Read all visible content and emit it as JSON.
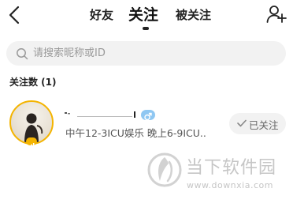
{
  "header": {
    "back_icon": "chevron-left-icon",
    "tabs": [
      {
        "label": "好友",
        "active": false
      },
      {
        "label": "关注",
        "active": true
      },
      {
        "label": "被关注",
        "active": false
      }
    ],
    "add_user_icon": "add-user-icon"
  },
  "search": {
    "placeholder": "请搜索昵称或ID",
    "value": ""
  },
  "section": {
    "title": "关注数 (1)"
  },
  "users": [
    {
      "signature": "中午12-3ICU娱乐 晚上6-9ICU..",
      "gender_icon": "male-icon",
      "button_label": "已关注"
    }
  ],
  "watermark": {
    "brand": "当下软件园",
    "url": "www.downxia.com"
  },
  "colors": {
    "accent": "#f4b400",
    "gender_badge": "#8fc7f2",
    "search_bg": "#f2f2f2",
    "watermark": "#c6c6c6"
  }
}
